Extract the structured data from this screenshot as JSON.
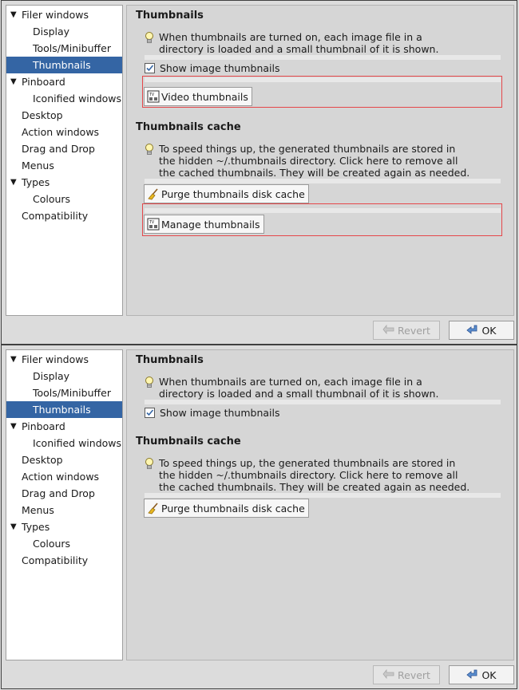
{
  "sidebar": {
    "items": [
      {
        "label": "Filer windows",
        "expander": "▼"
      },
      {
        "label": "Display"
      },
      {
        "label": "Tools/Minibuffer"
      },
      {
        "label": "Thumbnails",
        "selected": true
      },
      {
        "label": "Pinboard",
        "expander": "▼"
      },
      {
        "label": "Iconified windows"
      },
      {
        "label": "Desktop"
      },
      {
        "label": "Action windows"
      },
      {
        "label": "Drag and Drop"
      },
      {
        "label": "Menus"
      },
      {
        "label": "Types",
        "expander": "▼"
      },
      {
        "label": "Colours"
      },
      {
        "label": "Compatibility"
      }
    ]
  },
  "thumbnails": {
    "title": "Thumbnails",
    "hint_line1": "When thumbnails are turned on, each image file in a",
    "hint_line2": "directory is loaded and a small thumbnail of it is shown.",
    "show_label": "Show image thumbnails",
    "show_checked": true,
    "video_button": "Video thumbnails"
  },
  "cache": {
    "title": "Thumbnails cache",
    "hint_line1": "To speed things up, the generated thumbnails are stored in",
    "hint_line2": "the hidden ~/.thumbnails directory. Click here to remove all",
    "hint_line3": "the cached thumbnails. They will be created again as needed.",
    "purge_button": "Purge thumbnails disk cache",
    "manage_button": "Manage thumbnails"
  },
  "buttons": {
    "revert": "Revert",
    "ok": "OK"
  },
  "colors": {
    "selection": "#3465a4",
    "highlight_box": "#e5474a"
  },
  "icons": {
    "expander": "triangle-down-icon",
    "hint": "lightbulb-icon",
    "video": "video-thumbnail-icon",
    "purge": "broom-icon",
    "manage": "thumbnails-manager-icon",
    "revert": "revert-arrow-icon",
    "ok": "ok-arrow-icon"
  }
}
